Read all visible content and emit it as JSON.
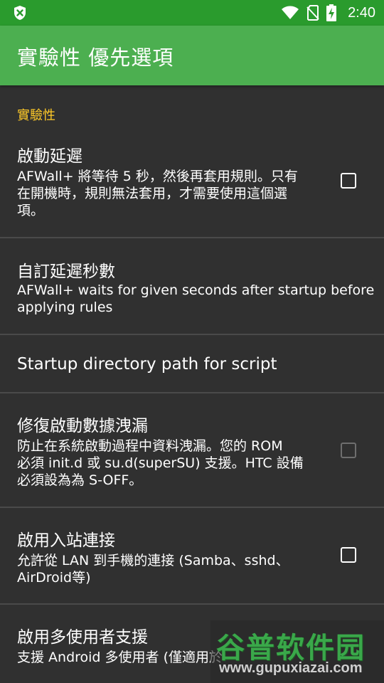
{
  "status_bar": {
    "time": "2:40",
    "left_icon": "shield-x-icon",
    "icons": [
      "wifi-icon",
      "no-sim-icon",
      "battery-charging-icon"
    ]
  },
  "app_bar": {
    "title": "實驗性 優先選項"
  },
  "category": {
    "label": "實驗性"
  },
  "preferences": [
    {
      "title": "啟動延遲",
      "summary_lines": [
        "AFWall+ 將等待 5 秒，然後再套用規則。只有",
        "在開機時，規則無法套用，才需要使用這個選",
        "項。"
      ],
      "checkbox": {
        "checked": false,
        "enabled": true
      }
    },
    {
      "title": "自訂延遲秒數",
      "summary_lines": [
        "AFWall+ waits for given seconds after startup before",
        "applying rules"
      ]
    },
    {
      "title": "Startup directory path for script"
    },
    {
      "title": "修復啟動數據洩漏",
      "summary_lines": [
        "防止在系統啟動過程中資料洩漏。您的 ROM",
        "必須 init.d 或 su.d(superSU) 支援。HTC 設備",
        "必須設為為 S-OFF。"
      ],
      "checkbox": {
        "checked": false,
        "enabled": false
      }
    },
    {
      "title": "啟用入站連接",
      "summary_lines": [
        "允許從 LAN 到手機的連接 (Samba、sshd、",
        "AirDroid等)"
      ],
      "checkbox": {
        "checked": false,
        "enabled": true
      }
    },
    {
      "title": "啟用多使用者支援",
      "summary_lines": [
        "支援 Android 多使用者 (僅適用於"
      ]
    }
  ],
  "watermark": {
    "title": "谷普软件园",
    "url": "www.gupuxiazai.com"
  },
  "colors": {
    "status_bar": "#2a9b2d",
    "app_bar": "#4caf50",
    "background": "#303030",
    "category": "#ffca28",
    "divider": "#4a4a4a"
  }
}
